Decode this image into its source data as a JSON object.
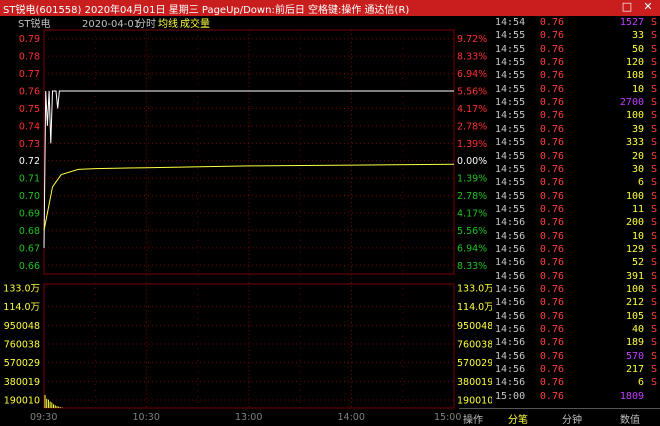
{
  "window": {
    "title": "ST锐电(601558) 2020年04月01日 星期三 PageUp/Down:前后日 空格键:操作 通达信(R)",
    "controls": [
      "□",
      "✕"
    ]
  },
  "chart_header": {
    "name": "ST锐电",
    "date": "2020-04-01",
    "period": "分时",
    "avg_label": "均线",
    "vol_label": "成交量"
  },
  "price_axis": {
    "left": [
      "0.79",
      "0.78",
      "0.77",
      "0.76",
      "0.75",
      "0.74",
      "0.73",
      "0.72",
      "0.71",
      "0.70",
      "0.69",
      "0.68",
      "0.67",
      "0.66"
    ],
    "right": [
      "9.72%",
      "8.33%",
      "6.94%",
      "5.56%",
      "4.17%",
      "2.78%",
      "1.39%",
      "0.00%",
      "1.39%",
      "2.78%",
      "4.17%",
      "5.56%",
      "6.94%",
      "8.33%"
    ],
    "colors": {
      "up": "#ff3030",
      "flat": "#ffffff",
      "down": "#20c020"
    }
  },
  "volume_axis": {
    "labels": [
      "133.0万",
      "114.0万",
      "950048",
      "760038",
      "570029",
      "380019",
      "190010"
    ]
  },
  "time_axis": [
    "09:30",
    "10:30",
    "13:00",
    "14:00",
    "15:00"
  ],
  "chart_data": {
    "type": "line",
    "series": [
      {
        "name": "",
        "x": [
          "09:30",
          "09:31",
          "09:32",
          "09:33",
          "09:34",
          "09:35",
          "09:36",
          "09:37",
          "09:38",
          "09:39",
          "09:40",
          "09:45",
          "09:50",
          "10:00",
          "15:00"
        ],
        "values": [
          0.67,
          0.76,
          0.74,
          0.76,
          0.73,
          0.76,
          0.76,
          0.76,
          0.75,
          0.76,
          0.76,
          0.76,
          0.76,
          0.76,
          0.76
        ]
      },
      {
        "name": "均线",
        "x": [
          "09:30",
          "09:35",
          "09:40",
          "09:50",
          "10:00",
          "10:30",
          "11:30",
          "14:00",
          "15:00"
        ],
        "values": [
          0.68,
          0.705,
          0.712,
          0.715,
          0.7155,
          0.716,
          0.717,
          0.7175,
          0.718
        ]
      },
      {
        "name": "成交量",
        "x": [
          "09:30",
          "09:31",
          "09:32",
          "09:33",
          "09:34",
          "09:35",
          "09:36",
          "09:37",
          "09:38",
          "09:39",
          "09:40"
        ],
        "values": [
          140000,
          100000,
          90000,
          70000,
          60000,
          40000,
          30000,
          20000,
          15000,
          8000,
          5000
        ]
      }
    ],
    "ylim": [
      0.655,
      0.795
    ],
    "prev_close": 0.72,
    "volume_max": 1330000
  },
  "ticks": [
    {
      "time": "14:54",
      "price": "0.76",
      "vol": "1527",
      "dir": "S",
      "vc": "#c040ff"
    },
    {
      "time": "14:55",
      "price": "0.76",
      "vol": "33",
      "dir": "S",
      "vc": "#ffff40"
    },
    {
      "time": "14:55",
      "price": "0.76",
      "vol": "50",
      "dir": "S",
      "vc": "#ffff40"
    },
    {
      "time": "14:55",
      "price": "0.76",
      "vol": "120",
      "dir": "S",
      "vc": "#ffff40"
    },
    {
      "time": "14:55",
      "price": "0.76",
      "vol": "108",
      "dir": "S",
      "vc": "#ffff40"
    },
    {
      "time": "14:55",
      "price": "0.76",
      "vol": "10",
      "dir": "S",
      "vc": "#ffff40"
    },
    {
      "time": "14:55",
      "price": "0.76",
      "vol": "2700",
      "dir": "S",
      "vc": "#c040ff"
    },
    {
      "time": "14:55",
      "price": "0.76",
      "vol": "100",
      "dir": "S",
      "vc": "#ffff40"
    },
    {
      "time": "14:55",
      "price": "0.76",
      "vol": "39",
      "dir": "S",
      "vc": "#ffff40"
    },
    {
      "time": "14:55",
      "price": "0.76",
      "vol": "333",
      "dir": "S",
      "vc": "#ffff40"
    },
    {
      "time": "14:55",
      "price": "0.76",
      "vol": "20",
      "dir": "S",
      "vc": "#ffff40"
    },
    {
      "time": "14:55",
      "price": "0.76",
      "vol": "30",
      "dir": "S",
      "vc": "#ffff40"
    },
    {
      "time": "14:55",
      "price": "0.76",
      "vol": "6",
      "dir": "S",
      "vc": "#ffff40"
    },
    {
      "time": "14:55",
      "price": "0.76",
      "vol": "100",
      "dir": "S",
      "vc": "#ffff40"
    },
    {
      "time": "14:55",
      "price": "0.76",
      "vol": "11",
      "dir": "S",
      "vc": "#ffff40"
    },
    {
      "time": "14:56",
      "price": "0.76",
      "vol": "200",
      "dir": "S",
      "vc": "#ffff40"
    },
    {
      "time": "14:56",
      "price": "0.76",
      "vol": "10",
      "dir": "S",
      "vc": "#ffff40"
    },
    {
      "time": "14:56",
      "price": "0.76",
      "vol": "129",
      "dir": "S",
      "vc": "#ffff40"
    },
    {
      "time": "14:56",
      "price": "0.76",
      "vol": "52",
      "dir": "S",
      "vc": "#ffff40"
    },
    {
      "time": "14:56",
      "price": "0.76",
      "vol": "391",
      "dir": "S",
      "vc": "#ffff40"
    },
    {
      "time": "14:56",
      "price": "0.76",
      "vol": "100",
      "dir": "S",
      "vc": "#ffff40"
    },
    {
      "time": "14:56",
      "price": "0.76",
      "vol": "212",
      "dir": "S",
      "vc": "#ffff40"
    },
    {
      "time": "14:56",
      "price": "0.76",
      "vol": "105",
      "dir": "S",
      "vc": "#ffff40"
    },
    {
      "time": "14:56",
      "price": "0.76",
      "vol": "40",
      "dir": "S",
      "vc": "#ffff40"
    },
    {
      "time": "14:56",
      "price": "0.76",
      "vol": "189",
      "dir": "S",
      "vc": "#ffff40"
    },
    {
      "time": "14:56",
      "price": "0.76",
      "vol": "570",
      "dir": "S",
      "vc": "#c040ff"
    },
    {
      "time": "14:56",
      "price": "0.76",
      "vol": "217",
      "dir": "S",
      "vc": "#ffff40"
    },
    {
      "time": "14:56",
      "price": "0.76",
      "vol": "6",
      "dir": "S",
      "vc": "#ffff40"
    },
    {
      "time": "15:00",
      "price": "0.76",
      "vol": "1809",
      "dir": "",
      "vc": "#c040ff"
    }
  ],
  "tabs": {
    "ops": "操作",
    "items": [
      "分笔",
      "分钟",
      "数值"
    ],
    "active": 0
  }
}
